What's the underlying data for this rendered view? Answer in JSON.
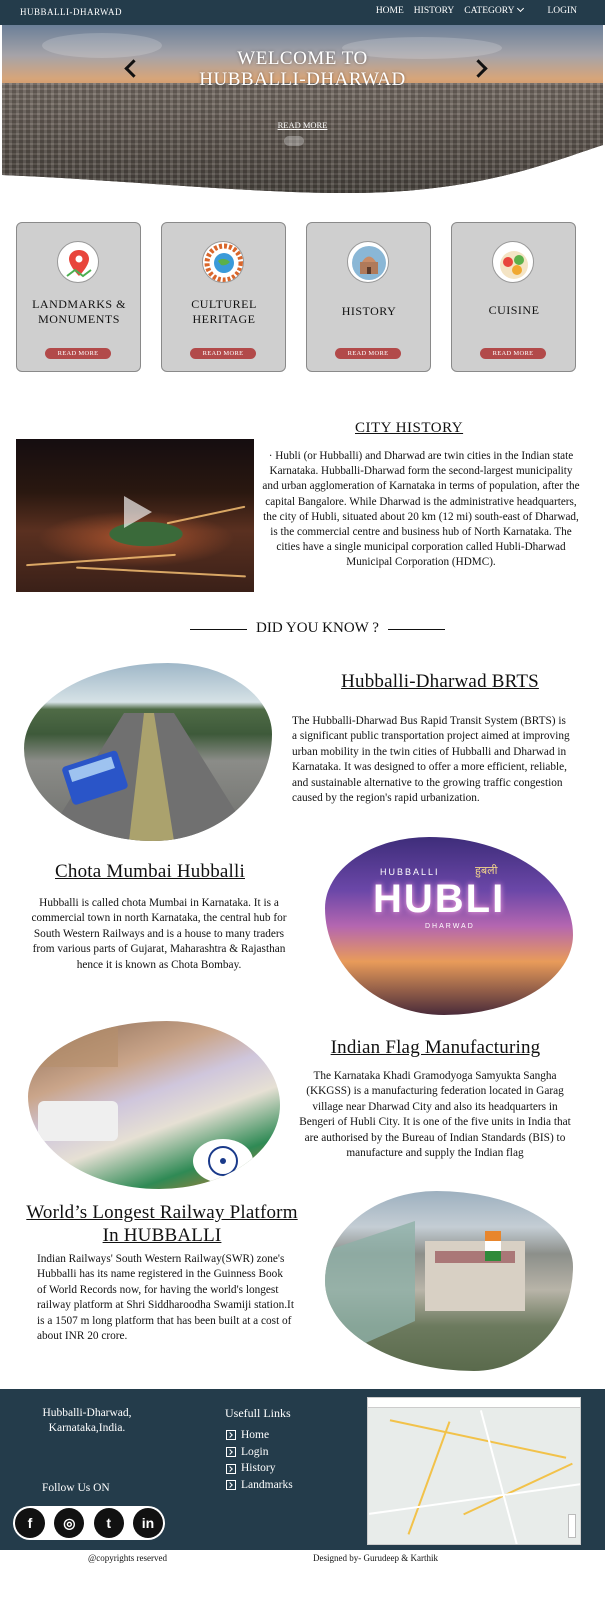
{
  "nav": {
    "brand": "HUBBALLI-DHARWAD",
    "links": [
      "HOME",
      "HISTORY",
      "CATEGORY"
    ],
    "login": "LOGIN"
  },
  "hero": {
    "title_line1": "WELCOME TO",
    "title_line2": "HUBBALLI-DHARWAD",
    "read_more": "READ MORE"
  },
  "cards": [
    {
      "title_line1": "LANDMARKS &",
      "title_line2": "MONUMENTS",
      "button": "READ MORE",
      "icon": "map-pin-icon"
    },
    {
      "title_line1": "CULTUREL",
      "title_line2": "HERITAGE",
      "button": "READ MORE",
      "icon": "culture-icon"
    },
    {
      "title_line1": "HISTORY",
      "title_line2": "",
      "button": "READ MORE",
      "icon": "monument-icon"
    },
    {
      "title_line1": "CUISINE",
      "title_line2": "",
      "button": "READ MORE",
      "icon": "food-icon"
    }
  ],
  "city_history": {
    "title": "CITY HISTORY",
    "text": "· Hubli (or Hubballi) and Dharwad are twin cities in the Indian state Karnataka. Hubballi-Dharwad form the second-largest municipality and urban agglomeration of Karnataka in terms of population, after the capital Bangalore. While Dharwad is the administrative headquarters, the city of Hubli, situated about 20 km (12 mi) south-east of Dharwad, is the commercial centre and business hub of North Karnataka. The cities have a single municipal corporation called Hubli-Dharwad Municipal Corporation (HDMC)."
  },
  "did_you_know": "DID YOU KNOW ?",
  "facts": [
    {
      "title": "Hubballi-Dharwad BRTS",
      "text": "The Hubballi-Dharwad Bus Rapid Transit System (BRTS) is a significant public transportation project aimed at improving urban mobility in the twin cities of Hubballi and Dharwad in Karnataka. It was designed to offer a more efficient, reliable, and sustainable alternative to the growing traffic congestion caused by the region's rapid urbanization."
    },
    {
      "title": "Chota Mumbai Hubballi",
      "text": "Hubballi is called chota Mumbai in Karnataka. It is a commercial town in north Karnataka, the central hub for South Western Railways and is a house to many traders from various parts of Gujarat, Maharashtra & Rajasthan hence it is known as Chota Bombay."
    },
    {
      "title": "Indian Flag Manufacturing",
      "text": "The Karnataka Khadi Gramodyoga Samyukta Sangha (KKGSS) is a manufacturing federation located in Garag village near Dharwad City and also its headquarters in Bengeri of Hubli City. It is one of the five units in India that are authorised by the Bureau of Indian Standards (BIS) to manufacture and supply the Indian flag"
    },
    {
      "title_line1": "World’s Longest Railway Platform",
      "title_line2": "In HUBBALLI",
      "text": "Indian Railways' South Western Railway(SWR) zone's Hubballi has its name registered in the Guinness Book of World Records now, for having the world's longest railway platform at Shri Siddharoodha Swamiji station.It is a 1507 m long platform that has been built at a cost of about INR 20 crore."
    }
  ],
  "hubli_sign": {
    "top": "HUBBALLI",
    "devanagari": "हुबली",
    "main": "HUBLI",
    "sub": "DHARWAD"
  },
  "footer": {
    "address_line1": "Hubballi-Dharwad,",
    "address_line2": "Karnataka,India.",
    "follow": "Follow Us ON",
    "social": [
      "f",
      "◎",
      "t",
      "in"
    ],
    "links_title": "Usefull Links",
    "links": [
      "Home",
      "Login",
      "History",
      "Landmarks"
    ]
  },
  "bottom": {
    "copyright": "@copyrights reserved",
    "designed": "Designed by- Gurudeep & Karthik"
  },
  "colors": {
    "nav": "#243c4b",
    "button": "#b24a4a",
    "card": "#cfcfcf"
  }
}
